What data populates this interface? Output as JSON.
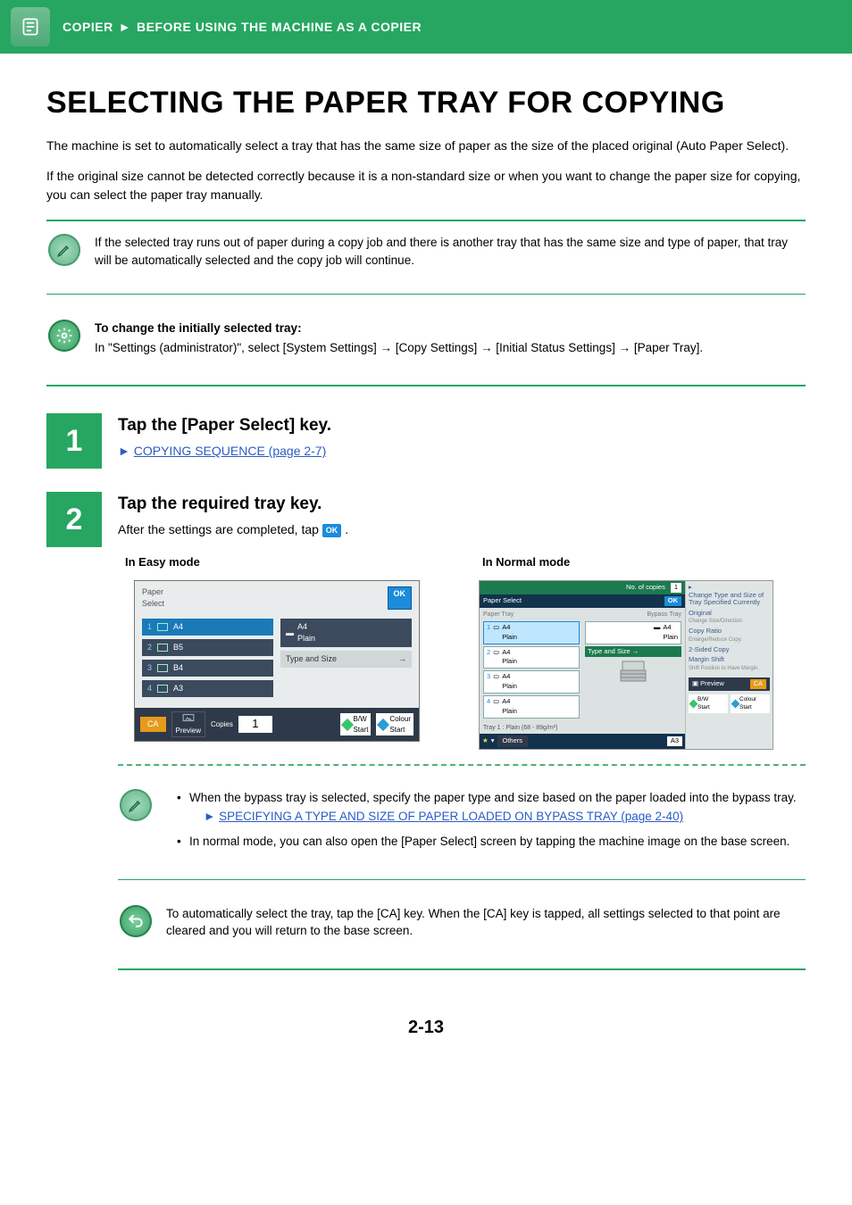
{
  "header": {
    "section": "COPIER",
    "separator": "►",
    "subsection": "BEFORE USING THE MACHINE AS A COPIER"
  },
  "title": "SELECTING THE PAPER TRAY FOR COPYING",
  "intro1": "The machine is set to automatically select a tray that has the same size of paper as the size of the placed original (Auto Paper Select).",
  "intro2": "If the original size cannot be detected correctly because it is a non-standard size or when you want to change the paper size for copying, you can select the paper tray manually.",
  "note_auto": "If the selected tray runs out of paper during a copy job and there is another tray that has the same size and type of paper, that tray will be automatically selected and the copy job will continue.",
  "note_change_title": "To change the initially selected tray:",
  "note_change_body": "In \"Settings (administrator)\", select [System Settings] → [Copy Settings] → [Initial Status Settings] → [Paper Tray].",
  "step1": {
    "num": "1",
    "title": "Tap the [Paper Select] key.",
    "link_arrow": "►",
    "link_text": "COPYING SEQUENCE (page 2-7)"
  },
  "step2": {
    "num": "2",
    "title": "Tap the required tray key.",
    "desc_before": "After the settings are completed, tap ",
    "desc_ok": "OK",
    "desc_after": " ."
  },
  "modes": {
    "easy_label": "In Easy mode",
    "normal_label": "In Normal mode"
  },
  "easy": {
    "panel_title": "Paper\nSelect",
    "ok": "OK",
    "trays": [
      {
        "n": "1",
        "size": "A4",
        "sel": true
      },
      {
        "n": "2",
        "size": "B5",
        "sel": false
      },
      {
        "n": "3",
        "size": "B4",
        "sel": false
      },
      {
        "n": "4",
        "size": "A3",
        "sel": false
      }
    ],
    "bypass_size": "A4",
    "bypass_type": "Plain",
    "type_size_btn": "Type and Size",
    "ca": "CA",
    "preview": "Preview",
    "copies_label": "Copies",
    "copies": "1",
    "bw": "B/W",
    "start": "Start",
    "colour": "Colour"
  },
  "normal": {
    "copies_label": "No. of copies",
    "copies": "1",
    "screen_title": "Paper Select",
    "ok": "OK",
    "paper_tray": "Paper Tray",
    "bypass_tray": "Bypass Tray",
    "trays": [
      {
        "n": "1",
        "size": "A4",
        "type": "Plain",
        "sel": true
      },
      {
        "n": "2",
        "size": "A4",
        "type": "Plain",
        "sel": false
      },
      {
        "n": "3",
        "size": "A4",
        "type": "Plain",
        "sel": false
      },
      {
        "n": "4",
        "size": "A4",
        "type": "Plain",
        "sel": false
      }
    ],
    "bypass_size": "A4",
    "bypass_type": "Plain",
    "type_size": "Type and Size",
    "tray_info": "Tray 1 : Plain (68 - 89g/m²)",
    "others": "Others",
    "a3": "A3",
    "side": [
      {
        "t": "Change Type and Size of Tray Specified Currently",
        "s": ""
      },
      {
        "t": "Original",
        "s": "Change Size/Direction."
      },
      {
        "t": "Copy Ratio",
        "s": "Enlarge/Reduce Copy."
      },
      {
        "t": "2-Sided Copy",
        "s": ""
      },
      {
        "t": "Margin Shift",
        "s": "Shift Position to Have Margin."
      }
    ],
    "preview": "Preview",
    "ca": "CA",
    "bw": "B/W",
    "start": "Start",
    "colour": "Colour"
  },
  "tips": {
    "bypass": "When the bypass tray is selected, specify the paper type and size based on the paper loaded into the bypass tray.",
    "bypass_link_arrow": "►",
    "bypass_link": "SPECIFYING A TYPE AND SIZE OF PAPER LOADED ON BYPASS TRAY (page 2-40)",
    "normal_tip": "In normal mode, you can also open the [Paper Select] screen by tapping the machine image on the base screen."
  },
  "undo_note": "To automatically select the tray, tap the [CA] key. When the [CA] key is tapped, all settings selected to that point are cleared and you will return to the base screen.",
  "page_number": "2-13"
}
